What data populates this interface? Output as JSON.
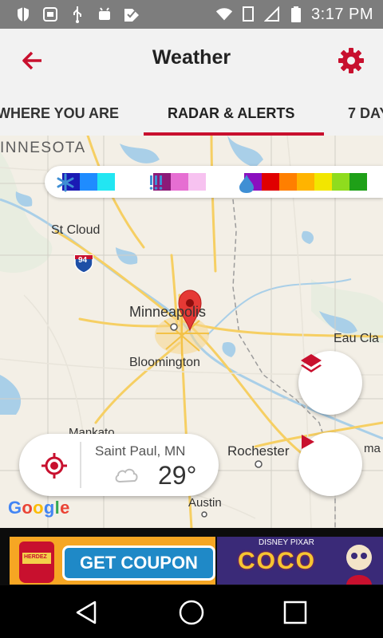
{
  "status_bar": {
    "time": "3:17 PM",
    "icons": [
      "shield-icon",
      "hd-icon",
      "usb-icon",
      "android-debug-icon",
      "check-icon",
      "wifi-icon",
      "no-sim-icon",
      "signal-icon",
      "battery-icon"
    ]
  },
  "app_bar": {
    "title": "Weather",
    "back_icon": "back-arrow-icon",
    "settings_icon": "gear-icon"
  },
  "tabs": [
    {
      "label": "WHERE YOU ARE",
      "active": false
    },
    {
      "label": "RADAR & ALERTS",
      "active": true
    },
    {
      "label": "7 DAYS",
      "active": false
    }
  ],
  "map": {
    "labels": {
      "minnesota": "INNESOTA",
      "st_cloud": "St Cloud",
      "interstate": "94",
      "minneapolis": "Minneapolis",
      "bloomington": "Bloomington",
      "eau_claire": "Eau Cla",
      "mankato": "Mankato",
      "rochester": "Rochester",
      "austin": "Austin",
      "ma": "ma"
    },
    "google": [
      "G",
      "o",
      "o",
      "g",
      "l",
      "e"
    ]
  },
  "legend": {
    "snow_icon": "snowflake-icon",
    "ice_icon": "ice-icon",
    "rain_icon": "raindrop-icon",
    "snow_colors": [
      "#1a1ab4",
      "#1f8cff",
      "#22e6f2"
    ],
    "ice_colors": [
      "#8c1a78",
      "#e66ed2",
      "#f7c2f0"
    ],
    "rain_colors": [
      "#8b0fbf",
      "#e00000",
      "#ff7f00",
      "#ffb400",
      "#f2e600",
      "#8fdc1e",
      "#1fa018"
    ]
  },
  "location_card": {
    "city": "Saint Paul, MN",
    "temperature": "29°",
    "condition_icon": "cloud-icon",
    "target_icon": "crosshair-icon"
  },
  "fabs": {
    "layers_icon": "layers-icon",
    "play_icon": "play-icon"
  },
  "ad": {
    "button_label": "GET COUPON",
    "brand_small": "DISNEY PIXAR",
    "movie_title": "COCO",
    "jar_label": "HERDEZ"
  },
  "nav_bar": {
    "back_icon": "nav-back-icon",
    "home_icon": "nav-home-icon",
    "recents_icon": "nav-recents-icon"
  },
  "colors": {
    "accent": "#c8102e",
    "status_bar": "#7d7d7d",
    "app_bar": "#f2f2f2",
    "map_bg": "#f3efe6",
    "water": "#a9cfe8",
    "road": "#f6cf63"
  }
}
